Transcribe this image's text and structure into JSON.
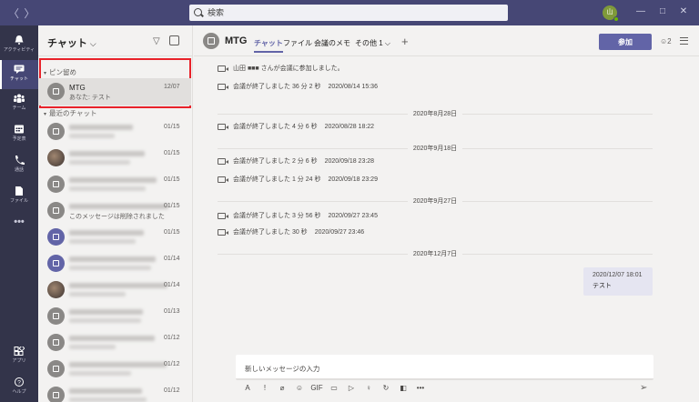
{
  "titlebar": {
    "back": "〈",
    "forward": "〉",
    "search_placeholder": "検索",
    "avatar_initials": "山",
    "minimize": "—",
    "maximize": "□",
    "close": "✕"
  },
  "rail": [
    {
      "label": "アクティビティ",
      "icon": "bell-icon"
    },
    {
      "label": "チャット",
      "icon": "chat-icon",
      "active": true
    },
    {
      "label": "チーム",
      "icon": "teams-icon"
    },
    {
      "label": "予定表",
      "icon": "calendar-icon"
    },
    {
      "label": "通話",
      "icon": "phone-icon"
    },
    {
      "label": "ファイル",
      "icon": "file-icon"
    },
    {
      "label": "•••",
      "icon": "more-icon"
    },
    {
      "label": "アプリ",
      "icon": "apps-icon"
    },
    {
      "label": "ヘルプ",
      "icon": "help-icon"
    }
  ],
  "chatlist": {
    "title": "チャット",
    "chevron": "⌵",
    "filter": "▽",
    "pinned_label": "ピン留め",
    "recent_label": "最近のチャット",
    "pinned": {
      "name": "MTG",
      "sub": "あなた: テスト",
      "date": "12/07"
    },
    "recent": [
      {
        "sub": "",
        "date": "01/15",
        "avatar": "gray"
      },
      {
        "sub": "",
        "date": "01/15",
        "avatar": "photo"
      },
      {
        "sub": "",
        "date": "01/15",
        "avatar": "gray"
      },
      {
        "sub": "このメッセージは削除されました",
        "date": "01/15",
        "avatar": "gray"
      },
      {
        "sub": "",
        "date": "01/15",
        "avatar": "purple"
      },
      {
        "sub": "",
        "date": "01/14",
        "avatar": "purple"
      },
      {
        "sub": "",
        "date": "01/14",
        "avatar": "photo"
      },
      {
        "sub": "",
        "date": "01/13",
        "avatar": "gray"
      },
      {
        "sub": "",
        "date": "01/12",
        "avatar": "gray"
      },
      {
        "sub": "",
        "date": "01/12",
        "avatar": "gray"
      },
      {
        "sub": "",
        "date": "01/12",
        "avatar": "gray"
      }
    ]
  },
  "main": {
    "title": "MTG",
    "tabs": [
      "チャット",
      "ファイル",
      "会議のメモ",
      "その他 1 ⌵"
    ],
    "add_tab": "+",
    "join_label": "参加",
    "participants": "2",
    "events": [
      {
        "text": "山田 ■■■ さんが会議に参加しました。",
        "time": ""
      },
      {
        "text": "会議が終了しました  36 分 2 秒",
        "time": "2020/08/14 15:36"
      },
      {
        "separator": "2020年8月28日"
      },
      {
        "text": "会議が終了しました  4 分 6 秒",
        "time": "2020/08/28 18:22"
      },
      {
        "separator": "2020年9月18日"
      },
      {
        "text": "会議が終了しました  2 分 6 秒",
        "time": "2020/09/18 23:28"
      },
      {
        "text": "会議が終了しました  1 分 24 秒",
        "time": "2020/09/18 23:29"
      },
      {
        "separator": "2020年9月27日"
      },
      {
        "text": "会議が終了しました  3 分 56 秒",
        "time": "2020/09/27 23:45"
      },
      {
        "text": "会議が終了しました  30 秒",
        "time": "2020/09/27 23:46"
      },
      {
        "separator": "2020年12月7日"
      }
    ],
    "my_message": {
      "time": "2020/12/07 18:01",
      "text": "テスト"
    },
    "composer_placeholder": "新しいメッセージの入力",
    "toolbar_icons": [
      "A",
      "!",
      "⌀",
      "☺",
      "GIF",
      "▭",
      "▷",
      "♀",
      "↻",
      "◧",
      "•••"
    ],
    "send": "➢"
  }
}
